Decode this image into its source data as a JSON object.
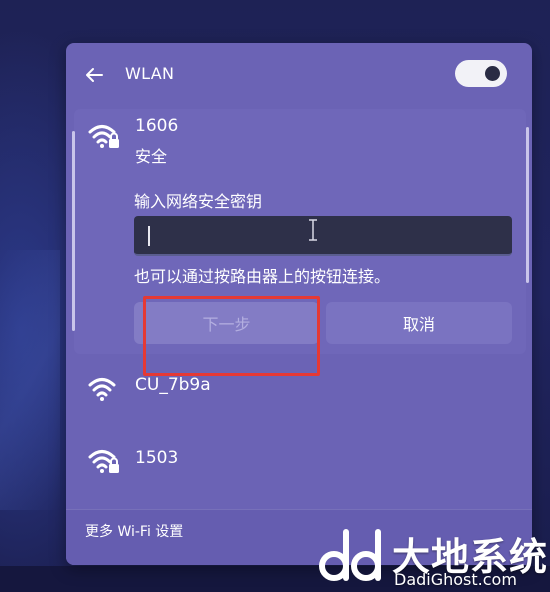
{
  "header": {
    "title": "WLAN",
    "wifi_enabled": true
  },
  "networks": [
    {
      "name": "1606",
      "status": "安全",
      "secured": true,
      "expanded": true,
      "password_label": "输入网络安全密钥",
      "password_value": "",
      "alt_connect_text": "也可以通过按路由器上的按钮连接。",
      "next_label": "下一步",
      "cancel_label": "取消"
    },
    {
      "name": "CU_7b9a",
      "secured": false
    },
    {
      "name": "1503",
      "secured": true
    }
  ],
  "footer": {
    "more_settings": "更多 Wi-Fi 设置"
  },
  "watermark": {
    "brand": "大地系统",
    "domain": "DadiGhost.com"
  },
  "colors": {
    "panel": "#6b63b5",
    "input_bg": "#2e3049",
    "highlight": "#e53935"
  }
}
